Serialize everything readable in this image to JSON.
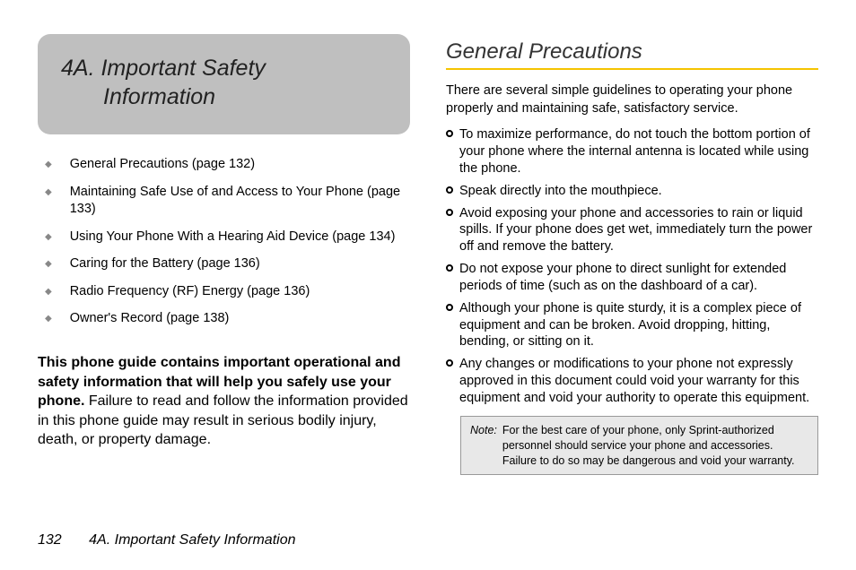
{
  "left": {
    "section_no": "4A.",
    "section_title_line1": "Important Safety",
    "section_title_line2": "Information",
    "toc": [
      "General Precautions (page 132)",
      "Maintaining Safe Use of and Access to Your Phone (page 133)",
      "Using Your Phone With a Hearing Aid Device (page 134)",
      "Caring for the Battery (page 136)",
      "Radio Frequency (RF) Energy (page 136)",
      "Owner's Record (page 138)"
    ],
    "warning_bold": "This phone guide contains important operational and safety information that will help you safely use your phone.",
    "warning_rest": " Failure to read and follow the information provided in this phone guide may result in serious bodily injury, death, or property damage."
  },
  "right": {
    "heading": "General Precautions",
    "intro": "There are several simple guidelines to operating your phone properly and maintaining safe, satisfactory service.",
    "bullets": [
      "To maximize performance, do not touch the bottom portion of your phone where the internal antenna is located while using the phone.",
      "Speak directly into the mouthpiece.",
      "Avoid exposing your phone and accessories to rain or liquid spills. If your phone does get wet, immediately turn the power off and remove the battery.",
      "Do not expose your phone to direct sunlight for extended periods of time (such as on the dashboard of a car).",
      "Although your phone is quite sturdy, it is a complex piece of equipment and can be broken. Avoid dropping, hitting, bending, or sitting on it.",
      "Any changes or modifications to your phone not expressly approved in this document could void your warranty for this equipment and void your authority to operate this equipment."
    ],
    "note_label": "Note:",
    "note_text": "For the best care of your phone, only Sprint-authorized personnel should service your phone and accessories. Failure to do so may be dangerous and void your warranty."
  },
  "footer": {
    "page": "132",
    "title": "4A. Important Safety Information"
  }
}
